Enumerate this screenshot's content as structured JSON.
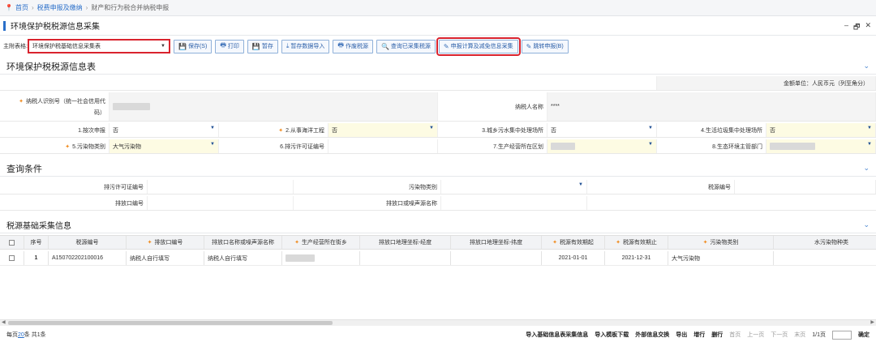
{
  "breadcrumb": {
    "home": "首页",
    "level1": "税费申报及缴纳",
    "current": "财产和行为税合并纳税申报"
  },
  "window": {
    "title": "环境保护税税源信息采集",
    "minimize": "–",
    "restore": "🗗",
    "close": "✕"
  },
  "toolbar": {
    "main_table_label": "主附表格:",
    "main_table_value": "环境保护税基础信息采集表",
    "buttons": {
      "save": "保存(S)",
      "print": "打印",
      "temp_save": "暂存",
      "import_temp": "暂存数据导入",
      "void": "作废税源",
      "query_collected": "查询已采集税源",
      "calc_collect": "申报计算及减免信息采集",
      "jump_declare": "跳转申报(B)"
    }
  },
  "section1": {
    "title": "环境保护税税源信息表",
    "currency_unit": "金额单位：人民币元（列至角分）",
    "taxpayer_id_label_1": "纳税人识别号（统一社会信用代",
    "taxpayer_id_label_2": "码）",
    "taxpayer_name_label": "纳税人名称",
    "taxpayer_name_value": "****",
    "f1_label": "1.按次申报",
    "f1_value": "否",
    "f2_label": "2.从事海洋工程",
    "f2_value": "否",
    "f3_label": "3.城乡污水集中处理场所",
    "f3_value": "否",
    "f4_label": "4.生活垃圾集中处理场所",
    "f4_value": "否",
    "f5_label": "5.污染物类别",
    "f5_value": "大气污染物",
    "f6_label": "6.排污许可证编号",
    "f7_label": "7.生产经营所在区划",
    "f8_label": "8.生态环境主管部门"
  },
  "query": {
    "title": "查询条件",
    "permit_label": "排污许可证编号",
    "pollutant_label": "污染物类别",
    "source_no_label": "税源编号",
    "outlet_no_label": "排放口编号",
    "outlet_name_label": "排放口或噪声源名称"
  },
  "grid": {
    "title": "税源基础采集信息",
    "columns": {
      "seq": "序号",
      "source_no": "税源编号",
      "outlet_no": "排放口编号",
      "outlet_name": "排放口名称或噪声源名称",
      "street": "生产经营所在街乡",
      "lon": "排放口地理坐标-经度",
      "lat": "排放口地理坐标-纬度",
      "valid_from": "税源有效期起",
      "valid_to": "税源有效期止",
      "pollutant": "污染物类别",
      "water": "水污染物种类"
    },
    "rows": [
      {
        "seq": "1",
        "source_no": "A150702202100016",
        "outlet_no": "纳税人自行填写",
        "outlet_name": "纳税人自行填写",
        "valid_from": "2021-01-01",
        "valid_to": "2021-12-31",
        "pollutant": "大气污染物"
      }
    ]
  },
  "pager": {
    "per_page_prefix": "每页",
    "per_page": "20",
    "per_page_suffix": "条 共1条",
    "import_basic": "导入基础信息表采集信息",
    "import_template": "导入模板下载",
    "external": "外部信息交换",
    "export": "导出",
    "add_row": "增行",
    "del_row": "删行",
    "first": "首页",
    "prev": "上一页",
    "next": "下一页",
    "last": "末页",
    "page_info": "1/1页",
    "confirm": "确定"
  }
}
